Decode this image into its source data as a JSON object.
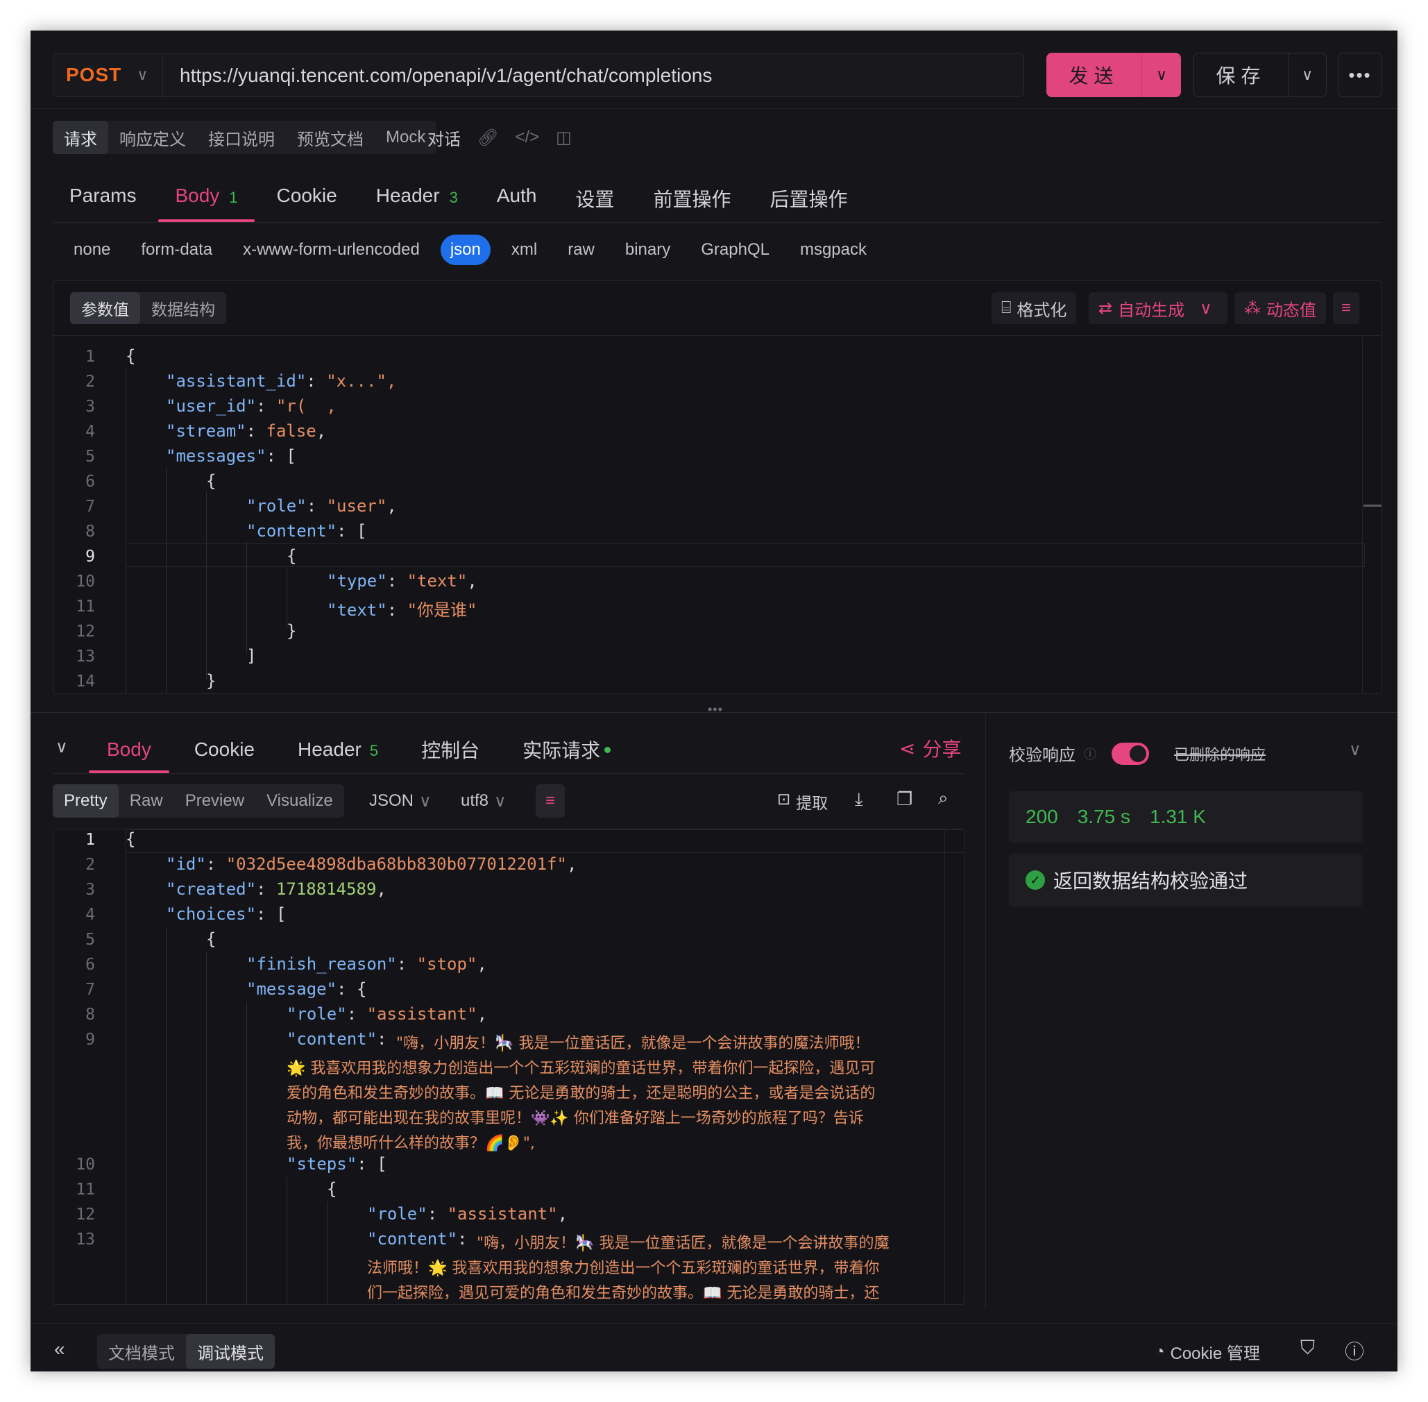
{
  "request": {
    "method": "POST",
    "url": "https://yuanqi.tencent.com/openapi/v1/agent/chat/completions",
    "send_label": "发送",
    "save_label": "保存"
  },
  "doc_tabs": [
    "请求",
    "响应定义",
    "接口说明",
    "预览文档",
    "Mock"
  ],
  "doc_extra_label": "对话",
  "main_tabs": [
    {
      "label": "Params"
    },
    {
      "label": "Body",
      "count": "1"
    },
    {
      "label": "Cookie"
    },
    {
      "label": "Header",
      "count": "3"
    },
    {
      "label": "Auth"
    },
    {
      "label": "设置"
    },
    {
      "label": "前置操作"
    },
    {
      "label": "后置操作"
    }
  ],
  "body_types": [
    "none",
    "form-data",
    "x-www-form-urlencoded",
    "json",
    "xml",
    "raw",
    "binary",
    "GraphQL",
    "msgpack"
  ],
  "editor": {
    "seg": [
      "参数值",
      "数据结构"
    ],
    "format_label": "格式化",
    "autogen_label": "自动生成",
    "dynamic_label": "动态值",
    "line_numbers": [
      "1",
      "2",
      "3",
      "4",
      "5",
      "6",
      "7",
      "8",
      "9",
      "10",
      "11",
      "12",
      "13",
      "14"
    ],
    "lines": {
      "l1": "{",
      "l2k": "\"assistant_id\"",
      "l2s": "\"x...\",",
      "l3k": "\"user_id\"",
      "l3s": "\"r(  ,",
      "l4k": "\"stream\"",
      "l4v": "false",
      "l5k": "\"messages\"",
      "l5p": "[",
      "l6": "{",
      "l7k": "\"role\"",
      "l7s": "\"user\"",
      "l8k": "\"content\"",
      "l8p": "[",
      "l9": "{",
      "l10k": "\"type\"",
      "l10s": "\"text\"",
      "l11k": "\"text\"",
      "l11s": "\"你是谁\"",
      "l12": "}",
      "l13": "]",
      "l14": "}"
    }
  },
  "response": {
    "tabs": [
      {
        "label": "Body"
      },
      {
        "label": "Cookie"
      },
      {
        "label": "Header",
        "count": "5"
      },
      {
        "label": "控制台"
      },
      {
        "label": "实际请求"
      }
    ],
    "share_label": "分享",
    "view_seg": [
      "Pretty",
      "Raw",
      "Preview",
      "Visualize"
    ],
    "format": "JSON",
    "encoding": "utf8",
    "extract_label": "提取",
    "line_numbers": [
      "1",
      "2",
      "3",
      "4",
      "5",
      "6",
      "7",
      "8",
      "9",
      "10",
      "11",
      "12",
      "13"
    ],
    "lines": {
      "l1": "{",
      "l2k": "\"id\"",
      "l2s": "\"032d5ee4898dba68bb830b077012201f\"",
      "l3k": "\"created\"",
      "l3n": "1718814589",
      "l4k": "\"choices\"",
      "l4p": "[",
      "l5": "{",
      "l6k": "\"finish_reason\"",
      "l6s": "\"stop\"",
      "l7k": "\"message\"",
      "l7p": "{",
      "l8k": "\"role\"",
      "l8s": "\"assistant\"",
      "l9k": "\"content\"",
      "l9a": "\"嗨，小朋友！🎠 我是一位童话匠，就像是一个会讲故事的魔法师哦！",
      "l9b": "🌟 我喜欢用我的想象力创造出一个个五彩斑斓的童话世界，带着你们一起探险，遇见可",
      "l9c": "爱的角色和发生奇妙的故事。📖 无论是勇敢的骑士，还是聪明的公主，或者是会说话的",
      "l9d": "动物，都可能出现在我的故事里呢！👾✨ 你们准备好踏上一场奇妙的旅程了吗？告诉",
      "l9e": "我，你最想听什么样的故事？🌈👂\",",
      "l10k": "\"steps\"",
      "l10p": "[",
      "l11": "{",
      "l12k": "\"role\"",
      "l12s": "\"assistant\"",
      "l13k": "\"content\"",
      "l13a": "\"嗨，小朋友！🎠 我是一位童话匠，就像是一个会讲故事的魔",
      "l13b": "法师哦！🌟 我喜欢用我的想象力创造出一个个五彩斑斓的童话世界，带着你",
      "l13c": "们一起探险，遇见可爱的角色和发生奇妙的故事。📖 无论是勇敢的骑士，还"
    }
  },
  "validation": {
    "label": "校验响应",
    "deleted_label": "已删除的响应",
    "status_code": "200",
    "time": "3.75 s",
    "size": "1.31 K",
    "result_text": "返回数据结构校验通过"
  },
  "footer": {
    "modes": [
      "文档模式",
      "调试模式"
    ],
    "cookie_label": "Cookie 管理"
  },
  "colors": {
    "accent": "#e6457f",
    "method": "#ee6a1f",
    "success": "#3fb950",
    "json_active": "#1f6feb"
  }
}
